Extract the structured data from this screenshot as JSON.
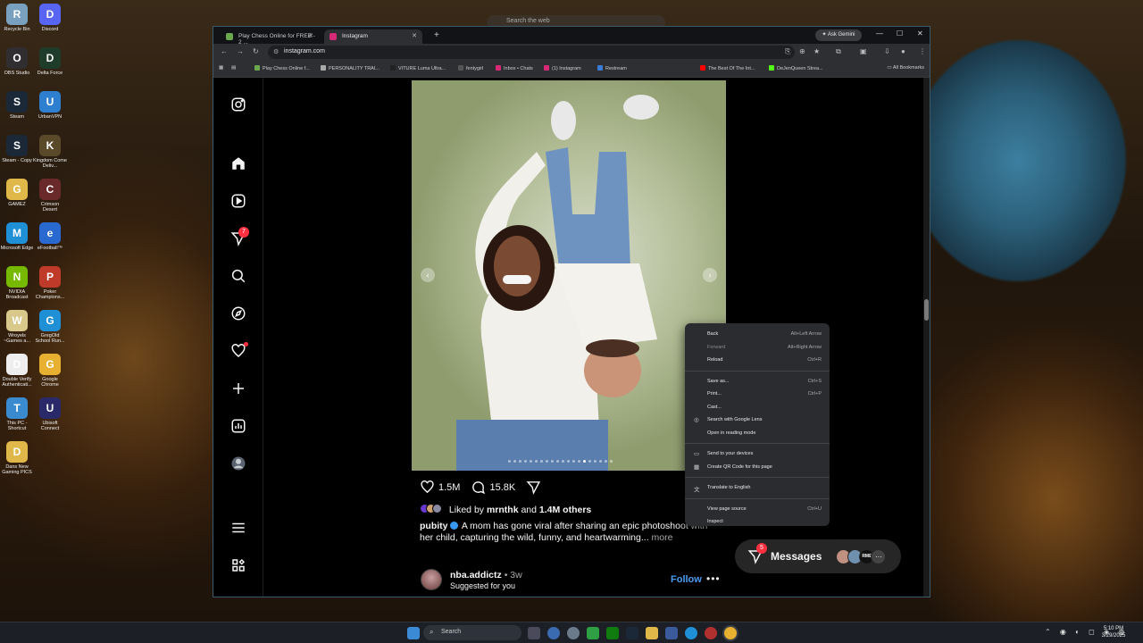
{
  "desktop": {
    "top_search_placeholder": "Search the web",
    "icons": [
      {
        "label": "Recycle Bin",
        "icon": "recycle-bin-icon",
        "color": "#7aa0c0"
      },
      {
        "label": "Discord",
        "icon": "discord-icon",
        "color": "#5865f2"
      },
      {
        "label": "OBS Studio",
        "icon": "obs-icon",
        "color": "#302e31"
      },
      {
        "label": "Delta Force",
        "icon": "delta-force-icon",
        "color": "#1f3b2a"
      },
      {
        "label": "Steam",
        "icon": "steam-icon",
        "color": "#1b2838"
      },
      {
        "label": "UrbanVPN",
        "icon": "urbanvpn-icon",
        "color": "#2f7fd0"
      },
      {
        "label": "Steam - Copy",
        "icon": "steam-icon",
        "color": "#1b2838"
      },
      {
        "label": "Kingdom Come Deliv...",
        "icon": "kingdom-come-icon",
        "color": "#5a4a2a"
      },
      {
        "label": "GAMEZ",
        "icon": "folder-icon",
        "color": "#e0b84a"
      },
      {
        "label": "Crimson Desert",
        "icon": "crimson-desert-icon",
        "color": "#6a2a2a"
      },
      {
        "label": "Microsoft Edge",
        "icon": "edge-icon",
        "color": "#1f8fd6"
      },
      {
        "label": "eFootball™",
        "icon": "efootball-icon",
        "color": "#2a6ad0"
      },
      {
        "label": "NVIDIA Broadcast",
        "icon": "nvidia-icon",
        "color": "#76b900"
      },
      {
        "label": "Poker Champions...",
        "icon": "poker-icon",
        "color": "#c03a2a"
      },
      {
        "label": "Wroyels ~Games a...",
        "icon": "file-icon",
        "color": "#d8c88a"
      },
      {
        "label": "GregOld School Run...",
        "icon": "edge-icon",
        "color": "#1f8fd6"
      },
      {
        "label": "Double Verify Authenticati...",
        "icon": "document-icon",
        "color": "#eeeeee"
      },
      {
        "label": "Google Chrome",
        "icon": "chrome-icon",
        "color": "#e8b030"
      },
      {
        "label": "This PC - Shortcut",
        "icon": "this-pc-icon",
        "color": "#3a8ad0"
      },
      {
        "label": "Ubisoft Connect",
        "icon": "ubisoft-icon",
        "color": "#2a2a6a"
      },
      {
        "label": "Dans New Gaming PICS",
        "icon": "folder-icon",
        "color": "#e0b84a"
      }
    ]
  },
  "browser": {
    "tabs": [
      {
        "label": "Play Chess Online for FREE - 2 ...",
        "favicon_color": "#6aa84f",
        "active": false
      },
      {
        "label": "Instagram",
        "favicon_color": "#d62976",
        "active": true
      }
    ],
    "ask_gemini": "Ask Gemini",
    "url": "instagram.com",
    "bookmarks": [
      {
        "label": "Play Chess Online f...",
        "color": "#6aa84f"
      },
      {
        "label": "PERSONALITY TRAI...",
        "color": "#aaaaaa"
      },
      {
        "label": "VITURE Luma Ultra...",
        "color": "#222222"
      },
      {
        "label": "fentygirl",
        "color": "#555555"
      },
      {
        "label": "Inbox • Chats",
        "color": "#d62976"
      },
      {
        "label": "(1) Instagram",
        "color": "#d62976"
      },
      {
        "label": "Restream",
        "color": "#3a7bd5"
      },
      {
        "label": "The Best Of The Int...",
        "color": "#ff0000"
      },
      {
        "label": "DeJenQueen Strea...",
        "color": "#53fc18"
      }
    ],
    "all_bookmarks": "All Bookmarks"
  },
  "instagram": {
    "sidebar": [
      {
        "name": "instagram-logo-icon"
      },
      {
        "name": "home-icon"
      },
      {
        "name": "reels-icon"
      },
      {
        "name": "messages-icon",
        "badge": "7"
      },
      {
        "name": "search-icon"
      },
      {
        "name": "explore-icon"
      },
      {
        "name": "notifications-icon"
      },
      {
        "name": "create-icon"
      },
      {
        "name": "dashboard-icon"
      },
      {
        "name": "profile-avatar"
      },
      {
        "name": "menu-icon"
      },
      {
        "name": "threads-icon"
      }
    ],
    "post": {
      "likes": "1.5M",
      "comments": "15.8K",
      "liked_by_prefix": "Liked by",
      "liked_by_user": "mrnthk",
      "liked_by_and": "and",
      "liked_by_others": "1.4M others",
      "author": "pubity",
      "caption": "A mom has gone viral after sharing an epic photoshoot with her child, capturing the wild, funny, and heartwarming...",
      "more": "more"
    },
    "next_post": {
      "username": "nba.addictz",
      "time": "• 3w",
      "subtitle": "Suggested for you",
      "follow": "Follow"
    },
    "messages": {
      "label": "Messages",
      "badge": "5",
      "avatar_tag": "RME"
    }
  },
  "context_menu": {
    "groups": [
      [
        {
          "label": "Back",
          "shortcut": "Alt+Left Arrow",
          "disabled": false
        },
        {
          "label": "Forward",
          "shortcut": "Alt+Right Arrow",
          "disabled": true
        },
        {
          "label": "Reload",
          "shortcut": "Ctrl+R",
          "disabled": false
        }
      ],
      [
        {
          "label": "Save as...",
          "shortcut": "Ctrl+S",
          "disabled": false
        },
        {
          "label": "Print...",
          "shortcut": "Ctrl+P",
          "disabled": false
        },
        {
          "label": "Cast...",
          "shortcut": "",
          "disabled": false
        },
        {
          "label": "Search with Google Lens",
          "shortcut": "",
          "disabled": false,
          "icon": "google-lens-icon"
        },
        {
          "label": "Open in reading mode",
          "shortcut": "",
          "disabled": false
        }
      ],
      [
        {
          "label": "Send to your devices",
          "shortcut": "",
          "disabled": false,
          "icon": "devices-icon"
        },
        {
          "label": "Create QR Code for this page",
          "shortcut": "",
          "disabled": false,
          "icon": "qr-code-icon"
        }
      ],
      [
        {
          "label": "Translate to English",
          "shortcut": "",
          "disabled": false,
          "icon": "translate-icon"
        }
      ],
      [
        {
          "label": "View page source",
          "shortcut": "Ctrl+U",
          "disabled": false
        },
        {
          "label": "Inspect",
          "shortcut": "",
          "disabled": false
        }
      ]
    ]
  },
  "taskbar": {
    "search_placeholder": "Search",
    "time": "5:10 PM",
    "date": "3/29/2025"
  }
}
